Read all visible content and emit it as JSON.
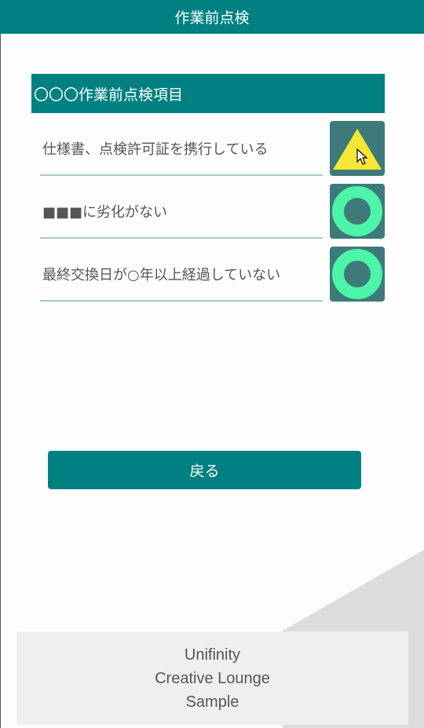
{
  "header": {
    "title": "作業前点検"
  },
  "section": {
    "title": "〇〇〇作業前点検項目"
  },
  "items": [
    {
      "label": "仕様書、点検許可証を携行している",
      "status": "triangle",
      "status_icon": "triangle-icon",
      "status_color": "#f7e734"
    },
    {
      "label": "■■■に劣化がない",
      "status": "circle",
      "status_icon": "circle-icon",
      "status_color": "#4cf5a8"
    },
    {
      "label": "最終交換日が○年以上経過していない",
      "status": "circle",
      "status_icon": "circle-icon",
      "status_color": "#4cf5a8"
    }
  ],
  "back_button": {
    "label": "戻る"
  },
  "footer": {
    "line1": "Unifinity",
    "line2": "Creative Lounge",
    "line3": "Sample"
  },
  "colors": {
    "primary": "#008080",
    "status_button_bg": "#3e7a7a",
    "circle_mark": "#4cf5a8",
    "triangle_mark": "#f7e734",
    "label_text": "#555555",
    "underline": "#a9c9cc"
  }
}
